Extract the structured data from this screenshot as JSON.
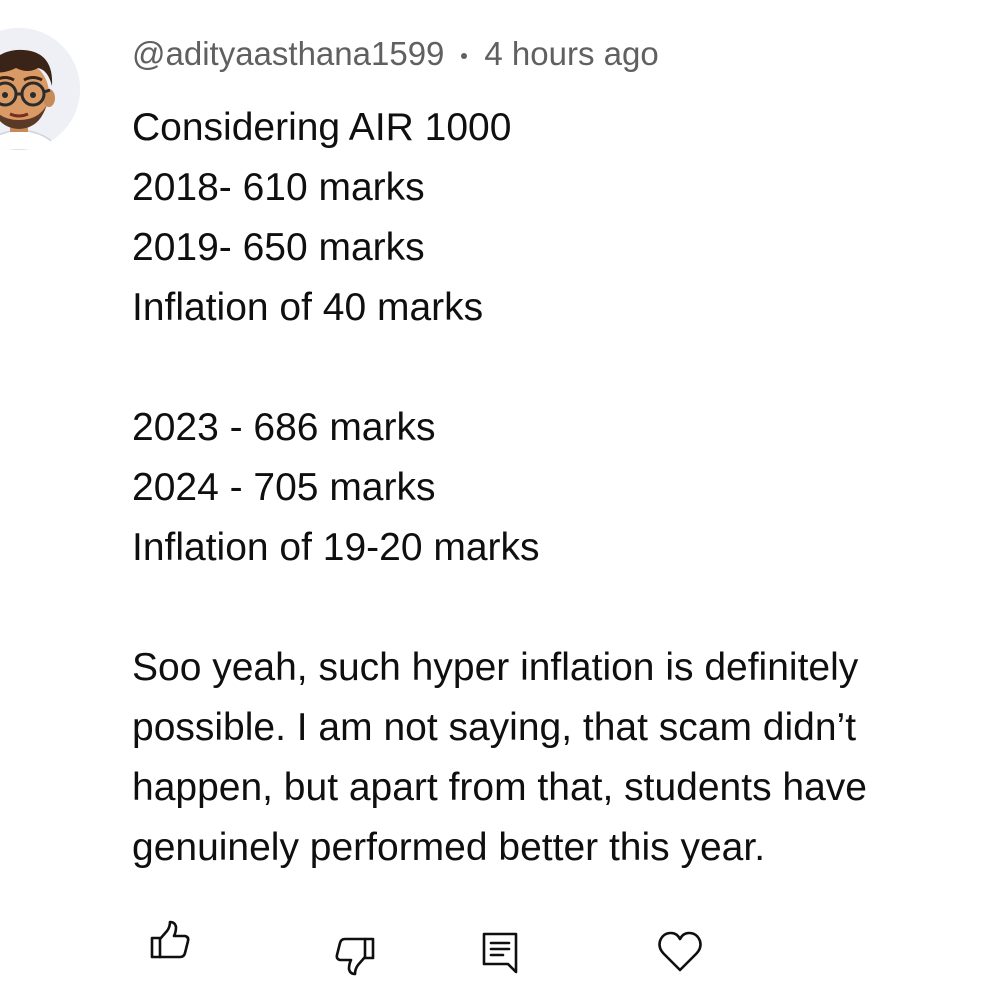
{
  "comment": {
    "username": "@adityaasthana1599",
    "separator": "•",
    "timestamp": "4 hours ago",
    "lines": [
      "Considering AIR 1000",
      "2018- 610 marks",
      "2019- 650 marks",
      "Inflation of 40 marks",
      "",
      "2023 - 686 marks",
      "2024 - 705 marks",
      "Inflation of 19-20 marks",
      "",
      "Soo yeah, such hyper inflation is definitely",
      "possible. I am not saying, that scam didn’t",
      "happen, but apart from that, students have",
      "genuinely performed better this year."
    ]
  },
  "actions": {
    "like_icon": "thumbs-up-icon",
    "dislike_icon": "thumbs-down-icon",
    "reply_icon": "reply-comment-icon",
    "heart_icon": "heart-icon"
  },
  "colors": {
    "text": "#0f0f0f",
    "meta": "#606060",
    "background": "#ffffff"
  }
}
